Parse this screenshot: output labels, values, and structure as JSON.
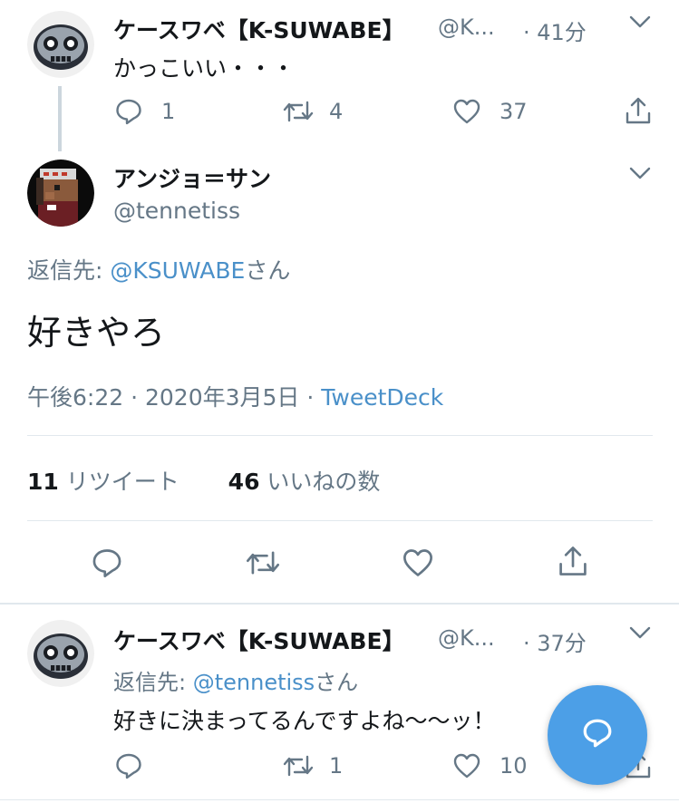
{
  "tweet1": {
    "name": "ケースワベ【K-SUWABE】",
    "handle": "@K...",
    "time": "· 41分",
    "text": "かっこいい・・・",
    "reply_count": "1",
    "retweet_count": "4",
    "like_count": "37"
  },
  "main": {
    "name": "アンジョ＝サン",
    "handle": "@tennetiss",
    "reply_to_prefix": "返信先: ",
    "reply_to_handle": "@KSUWABE",
    "reply_to_suffix": "さん",
    "text": "好きやろ",
    "timestamp": "午後6:22 · 2020年3月5日 · ",
    "source": "TweetDeck",
    "retweets_num": "11",
    "retweets_label": "リツイート",
    "likes_num": "46",
    "likes_label": "いいねの数"
  },
  "tweet3": {
    "name": "ケースワベ【K-SUWABE】",
    "handle": "@K...",
    "time": "· 37分",
    "reply_to_prefix": "返信先: ",
    "reply_to_handle": "@tennetiss",
    "reply_to_suffix": "さん",
    "text": "好きに決まってるんですよね〜〜ッ！",
    "reply_count": "1",
    "like_count": "10"
  },
  "colors": {
    "accent": "#4a90c9",
    "fab": "#4c9fe7",
    "muted": "#657786",
    "divider": "#e1e8ed"
  },
  "icons": [
    "chevron-down-icon",
    "reply-icon",
    "retweet-icon",
    "like-icon",
    "share-icon",
    "compose-reply-icon"
  ]
}
